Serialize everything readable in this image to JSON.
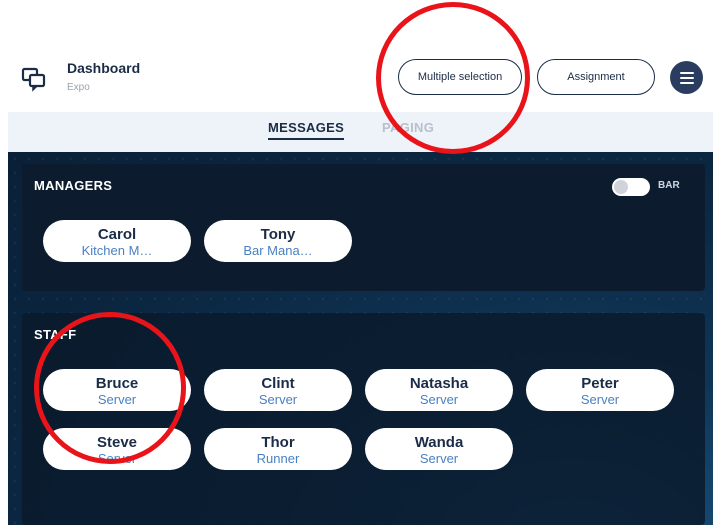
{
  "header": {
    "title": "Dashboard",
    "subtitle": "Expo",
    "multiple_selection_label": "Multiple selection",
    "assignment_label": "Assignment"
  },
  "tabs": [
    {
      "label": "MESSAGES",
      "active": true
    },
    {
      "label": "PAGING",
      "active": false
    }
  ],
  "managers": {
    "heading": "MANAGERS",
    "toggle_label": "BAR",
    "people": [
      {
        "name": "Carol",
        "role": "Kitchen M…"
      },
      {
        "name": "Tony",
        "role": "Bar Mana…"
      }
    ]
  },
  "staff": {
    "heading": "STAFF",
    "people": [
      {
        "name": "Bruce",
        "role": "Server"
      },
      {
        "name": "Clint",
        "role": "Server"
      },
      {
        "name": "Natasha",
        "role": "Server"
      },
      {
        "name": "Peter",
        "role": "Server"
      },
      {
        "name": "Steve",
        "role": "Server"
      },
      {
        "name": "Thor",
        "role": "Runner"
      },
      {
        "name": "Wanda",
        "role": "Server"
      }
    ]
  },
  "colors": {
    "brand_navy": "#1b2c47",
    "role_blue": "#4a80c2",
    "annotation_red": "#e8141a"
  }
}
